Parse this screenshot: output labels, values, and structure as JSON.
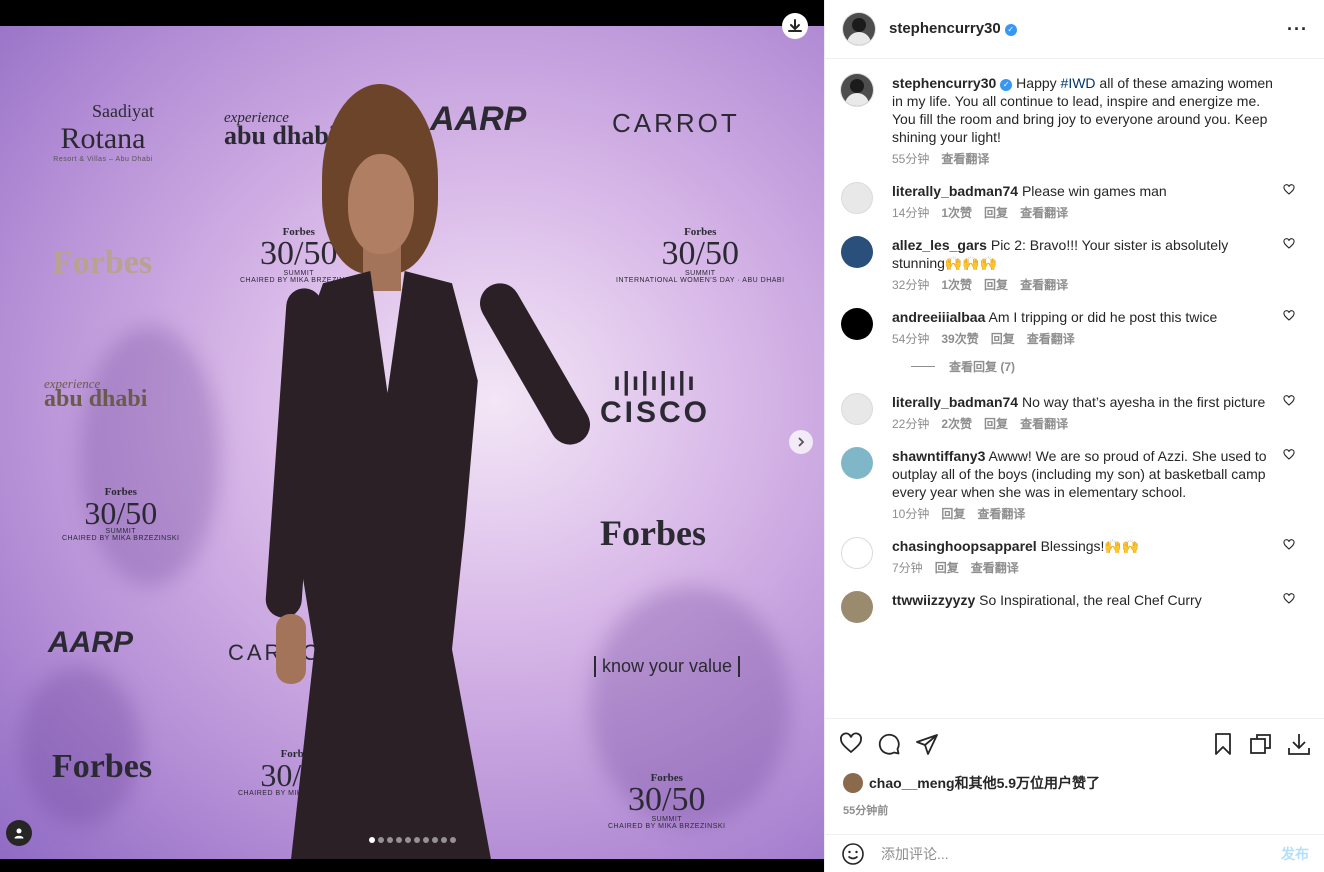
{
  "post": {
    "author": "stephencurry30",
    "verified": true,
    "caption_pre": "Happy ",
    "caption_tag": "#IWD",
    "caption_post": " all of these amazing women in my life. You all continue to lead, inspire and energize me. You fill the room and bring joy to everyone around you. Keep shining your light!",
    "caption_time": "55分钟",
    "caption_translate": "查看翻译",
    "more_icon": "more-horizontal-icon"
  },
  "media": {
    "sponsors": {
      "rotana_top": "Saadiyat",
      "rotana_main": "Rotana",
      "rotana_sub": "Resort & Villas – Abu Dhabi",
      "experience": "experience",
      "abu_dhabi": "abu dhabi",
      "aarp": "AARP",
      "carrot": "CARROT",
      "forbes": "Forbes",
      "summit_forbes": "Forbes",
      "summit_num": "30/50",
      "summit_label": "SUMMIT",
      "summit_sub": "INTERNATIONAL WOMEN'S DAY · ABU DHABI",
      "summit_chair": "CHAIRED BY MIKA BRZEZINSKI",
      "cisco": "CISCO",
      "kyv": "know your value"
    },
    "carousel_total": 10,
    "carousel_index": 0
  },
  "comments": [
    {
      "user": "literally_badman74",
      "text": "Please win games man",
      "time": "14分钟",
      "likes": "1次赞",
      "reply": "回复",
      "translate": "查看翻译",
      "avatar_color": "#e8e8e8"
    },
    {
      "user": "allez_les_gars",
      "text": "Pic 2: Bravo!!! Your sister is absolutely stunning🙌🙌🙌",
      "time": "32分钟",
      "likes": "1次赞",
      "reply": "回复",
      "translate": "查看翻译",
      "avatar_color": "#2a4f7a"
    },
    {
      "user": "andreeiiialbaa",
      "text": "Am I tripping or did he post this twice",
      "time": "54分钟",
      "likes": "39次赞",
      "reply": "回复",
      "translate": "查看翻译",
      "avatar_color": "#000000",
      "replies_label": "查看回复 (7)"
    },
    {
      "user": "literally_badman74",
      "text": "No way that’s ayesha in the first picture",
      "time": "22分钟",
      "likes": "2次赞",
      "reply": "回复",
      "translate": "查看翻译",
      "avatar_color": "#e8e8e8"
    },
    {
      "user": "shawntiffany3",
      "text": "Awww! We are so proud of Azzi. She used to outplay all of the boys (including my son) at basketball camp every year when she was in elementary school.",
      "time": "10分钟",
      "likes": "",
      "reply": "回复",
      "translate": "查看翻译",
      "avatar_color": "#7fb7c9"
    },
    {
      "user": "chasinghoopsapparel",
      "text": "Blessings!🙌🙌",
      "time": "7分钟",
      "likes": "",
      "reply": "回复",
      "translate": "查看翻译",
      "avatar_color": "#ffffff"
    },
    {
      "user": "ttwwiizzyyzy",
      "text": "So Inspirational, the real Chef Curry",
      "time": "",
      "likes": "",
      "reply": "",
      "translate": "",
      "avatar_color": "#9a8a6e"
    }
  ],
  "likes": {
    "user": "chao__meng",
    "text": "和其他5.9万位用户赞了"
  },
  "posted_ago": "55分钟前",
  "add_comment": {
    "placeholder": "添加评论...",
    "post_label": "发布"
  }
}
